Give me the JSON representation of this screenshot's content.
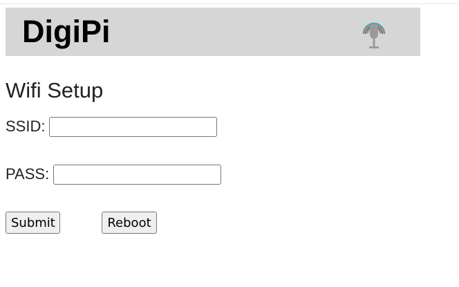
{
  "header": {
    "title": "DigiPi",
    "logo_icon": "microphone-radio-icon"
  },
  "main": {
    "title": "Wifi Setup",
    "ssid": {
      "label": "SSID:",
      "value": ""
    },
    "pass": {
      "label": "PASS:",
      "value": ""
    },
    "submit_label": "Submit",
    "reboot_label": "Reboot"
  },
  "colors": {
    "header_bg": "#d6d6d6",
    "mic_arc_outer": "#e0504a",
    "mic_arc_inner": "#3aa8b0",
    "mic_body": "#9a9a9a"
  }
}
